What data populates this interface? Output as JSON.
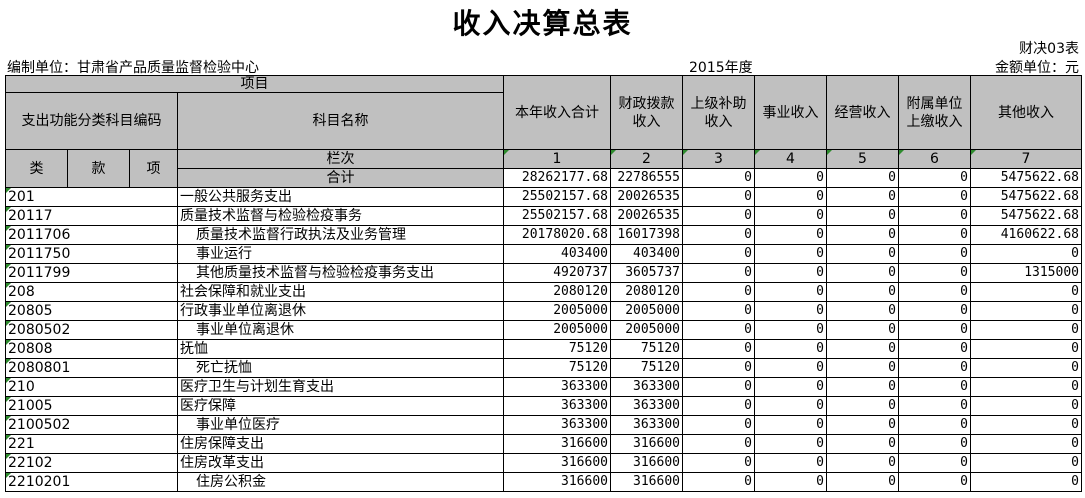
{
  "title": "收入决算总表",
  "form_code": "财决03表",
  "unit_label": "编制单位：甘肃省产品质量监督检验中心",
  "year_label": "2015年度",
  "currency_label": "金额单位：元",
  "headers": {
    "item": "项目",
    "func_code": "支出功能分类科目编码",
    "subject_name": "科目名称",
    "cols": [
      "本年收入合计",
      "财政拨款收入",
      "上级补助收入",
      "事业收入",
      "经营收入",
      "附属单位上缴收入",
      "其他收入"
    ],
    "lei": "类",
    "kuan": "款",
    "xiang": "项",
    "lanci": "栏次",
    "col_nums": [
      "1",
      "2",
      "3",
      "4",
      "5",
      "6",
      "7"
    ]
  },
  "total_label": "合计",
  "total_values": [
    "28262177.68",
    "22786555",
    "0",
    "0",
    "0",
    "0",
    "5475622.68"
  ],
  "rows": [
    {
      "code": "201",
      "name": "一般公共服务支出",
      "indent": false,
      "values": [
        "25502157.68",
        "20026535",
        "0",
        "0",
        "0",
        "0",
        "5475622.68"
      ]
    },
    {
      "code": "20117",
      "name": "质量技术监督与检验检疫事务",
      "indent": false,
      "values": [
        "25502157.68",
        "20026535",
        "0",
        "0",
        "0",
        "0",
        "5475622.68"
      ]
    },
    {
      "code": "2011706",
      "name": "质量技术监督行政执法及业务管理",
      "indent": true,
      "values": [
        "20178020.68",
        "16017398",
        "0",
        "0",
        "0",
        "0",
        "4160622.68"
      ]
    },
    {
      "code": "2011750",
      "name": "事业运行",
      "indent": true,
      "values": [
        "403400",
        "403400",
        "0",
        "0",
        "0",
        "0",
        "0"
      ]
    },
    {
      "code": "2011799",
      "name": "其他质量技术监督与检验检疫事务支出",
      "indent": true,
      "values": [
        "4920737",
        "3605737",
        "0",
        "0",
        "0",
        "0",
        "1315000"
      ]
    },
    {
      "code": "208",
      "name": "社会保障和就业支出",
      "indent": false,
      "values": [
        "2080120",
        "2080120",
        "0",
        "0",
        "0",
        "0",
        "0"
      ]
    },
    {
      "code": "20805",
      "name": "行政事业单位离退休",
      "indent": false,
      "values": [
        "2005000",
        "2005000",
        "0",
        "0",
        "0",
        "0",
        "0"
      ]
    },
    {
      "code": "2080502",
      "name": "事业单位离退休",
      "indent": true,
      "values": [
        "2005000",
        "2005000",
        "0",
        "0",
        "0",
        "0",
        "0"
      ]
    },
    {
      "code": "20808",
      "name": "抚恤",
      "indent": false,
      "values": [
        "75120",
        "75120",
        "0",
        "0",
        "0",
        "0",
        "0"
      ]
    },
    {
      "code": "2080801",
      "name": "死亡抚恤",
      "indent": true,
      "values": [
        "75120",
        "75120",
        "0",
        "0",
        "0",
        "0",
        "0"
      ]
    },
    {
      "code": "210",
      "name": "医疗卫生与计划生育支出",
      "indent": false,
      "values": [
        "363300",
        "363300",
        "0",
        "0",
        "0",
        "0",
        "0"
      ]
    },
    {
      "code": "21005",
      "name": "医疗保障",
      "indent": false,
      "values": [
        "363300",
        "363300",
        "0",
        "0",
        "0",
        "0",
        "0"
      ]
    },
    {
      "code": "2100502",
      "name": "事业单位医疗",
      "indent": true,
      "values": [
        "363300",
        "363300",
        "0",
        "0",
        "0",
        "0",
        "0"
      ]
    },
    {
      "code": "221",
      "name": "住房保障支出",
      "indent": false,
      "values": [
        "316600",
        "316600",
        "0",
        "0",
        "0",
        "0",
        "0"
      ]
    },
    {
      "code": "22102",
      "name": "住房改革支出",
      "indent": false,
      "values": [
        "316600",
        "316600",
        "0",
        "0",
        "0",
        "0",
        "0"
      ]
    },
    {
      "code": "2210201",
      "name": "住房公积金",
      "indent": true,
      "values": [
        "316600",
        "316600",
        "0",
        "0",
        "0",
        "0",
        "0"
      ]
    }
  ],
  "colors": {
    "header_bg": "#c0c0c0",
    "cell_marker": "#2e8b2e"
  }
}
